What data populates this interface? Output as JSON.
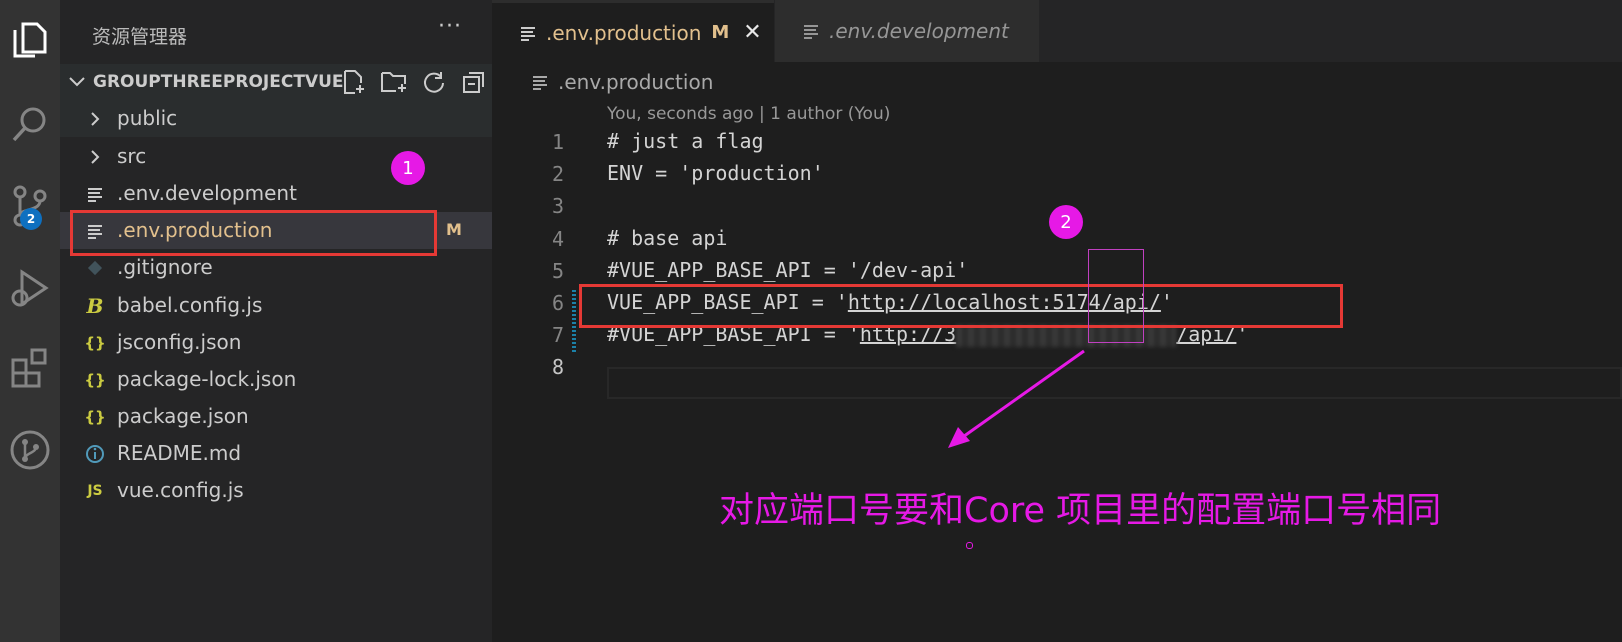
{
  "activity_bar": {
    "icons": [
      "explorer-icon",
      "search-icon",
      "source-control-icon",
      "run-debug-icon",
      "extensions-icon",
      "git-graph-icon"
    ],
    "scm_badge": "2"
  },
  "sidebar": {
    "title": "资源管理器",
    "more_label": "···",
    "project_name": "GROUPTHREEPROJECTVUE",
    "files": [
      {
        "name": "public",
        "kind": "folder"
      },
      {
        "name": "src",
        "kind": "folder"
      },
      {
        "name": ".env.development",
        "kind": "text"
      },
      {
        "name": ".env.production",
        "kind": "text",
        "status": "M"
      },
      {
        "name": ".gitignore",
        "kind": "git"
      },
      {
        "name": "babel.config.js",
        "kind": "babel"
      },
      {
        "name": "jsconfig.json",
        "kind": "json"
      },
      {
        "name": "package-lock.json",
        "kind": "json"
      },
      {
        "name": "package.json",
        "kind": "json"
      },
      {
        "name": "README.md",
        "kind": "info"
      },
      {
        "name": "vue.config.js",
        "kind": "js"
      }
    ]
  },
  "tabs": [
    {
      "label": ".env.production",
      "modified": "M",
      "close": "✕",
      "active": true
    },
    {
      "label": ".env.development",
      "active": false
    }
  ],
  "breadcrumb": ".env.production",
  "codelens": "You, seconds ago | 1 author (You)",
  "code_lines": [
    {
      "n": "1",
      "text": "# just a flag"
    },
    {
      "n": "2",
      "text": "ENV = 'production'"
    },
    {
      "n": "3",
      "text": ""
    },
    {
      "n": "4",
      "text": "# base api"
    },
    {
      "n": "5",
      "text": "#VUE_APP_BASE_API = '/dev-api'"
    },
    {
      "n": "6",
      "prefix": "VUE_APP_BASE_API = '",
      "link": "http://localhost:5174/api/",
      "suffix": "'"
    },
    {
      "n": "7",
      "prefix": "#VUE_APP_BASE_API = '",
      "link_start": "http://3",
      "link_end": "/api/",
      "suffix": "'"
    },
    {
      "n": "8",
      "text": ""
    }
  ],
  "annotations": {
    "marker_1": "1",
    "marker_2": "2",
    "note": "对应端口号要和Core 项目里的配置端口号相同"
  },
  "colors": {
    "annotation_magenta": "#e619e6",
    "highlight_red": "#e53935",
    "modified_yellow": "#e2c08d"
  }
}
